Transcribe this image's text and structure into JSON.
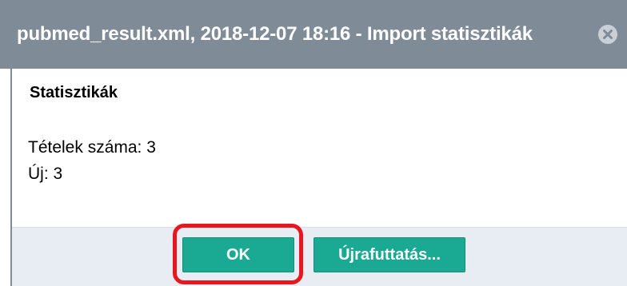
{
  "dialog": {
    "title": "pubmed_result.xml, 2018-12-07 18:16 - Import statisztikák",
    "close_icon": "close-circle-icon",
    "section_title": "Statisztikák",
    "stats": {
      "items_line": "Tételek száma: 3",
      "new_line": "Új: 3"
    },
    "buttons": {
      "ok_label": "OK",
      "rerun_label": "Újrafuttatás..."
    }
  },
  "colors": {
    "titlebar": "#7f8c98",
    "button": "#1aa992",
    "footer": "#e7edf3",
    "highlight": "#e8161e"
  }
}
